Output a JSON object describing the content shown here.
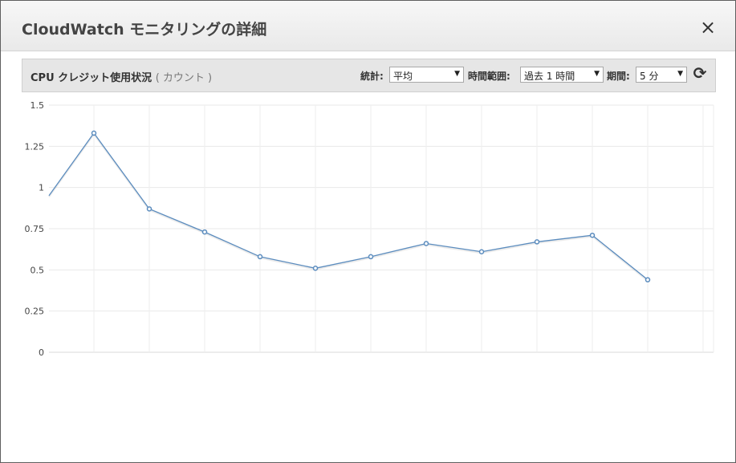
{
  "modal": {
    "title": "CloudWatch モニタリングの詳細",
    "close_label": "×"
  },
  "panel": {
    "metric_name": "CPU クレジット使用状況",
    "metric_unit": "( カウント )",
    "statistic_label": "統計:",
    "statistic_value": "平均",
    "time_range_label": "時間範囲:",
    "time_range_value": "過去 1 時間",
    "period_label": "期間:",
    "period_value": "5 分",
    "refresh_icon": "refresh-icon"
  },
  "chart_data": {
    "type": "line",
    "title": "",
    "xlabel": "",
    "ylabel": "",
    "ylim": [
      0,
      1.5
    ],
    "yticks": [
      "1.5",
      "1.25",
      "1",
      "0.75",
      "0.5",
      "0.25",
      "0"
    ],
    "grid": true,
    "series": [
      {
        "color": "#5b8cbe",
        "values": [
          0.95,
          1.33,
          0.87,
          0.73,
          0.58,
          0.51,
          0.58,
          0.66,
          0.61,
          0.67,
          0.71,
          0.44
        ]
      }
    ]
  }
}
